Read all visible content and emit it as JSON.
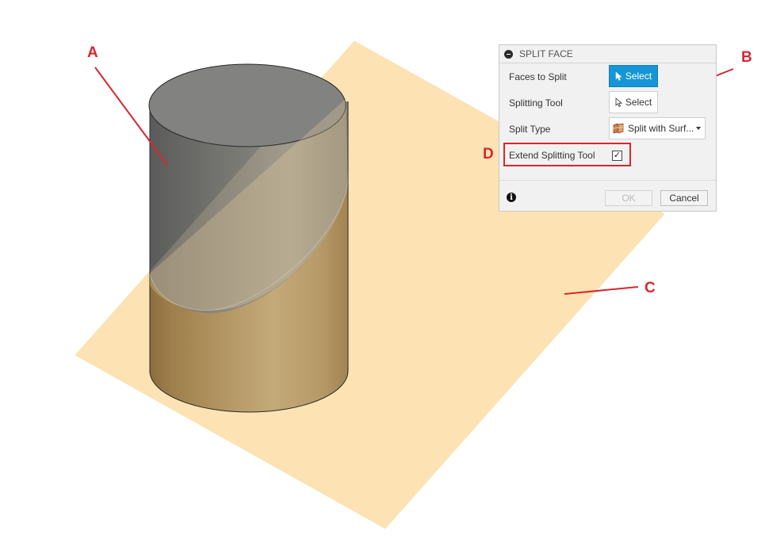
{
  "callouts": {
    "a": "A",
    "b": "B",
    "c": "C",
    "d": "D"
  },
  "dialog": {
    "title": "SPLIT FACE",
    "faces_to_split": {
      "label": "Faces to Split",
      "button": "Select"
    },
    "splitting_tool": {
      "label": "Splitting Tool",
      "button": "Select"
    },
    "split_type": {
      "label": "Split Type",
      "value": "Split with Surf..."
    },
    "extend_splitting_tool": {
      "label": "Extend Splitting Tool",
      "checked": true,
      "check_glyph": "✓"
    },
    "info": "i",
    "ok": "OK",
    "cancel": "Cancel"
  },
  "icons": {
    "collapse": "minus-circle-icon",
    "cursor": "arrow-cursor-icon",
    "surface": "split-surface-icon",
    "dropdown": "chevron-down-icon",
    "info": "info-icon"
  },
  "colors": {
    "callout": "#d9262e",
    "select_active": "#1696d6",
    "plane": "#fde3b3",
    "cylinder_dark": "#6f6f6f",
    "cylinder_gold": "#9b7d47"
  }
}
